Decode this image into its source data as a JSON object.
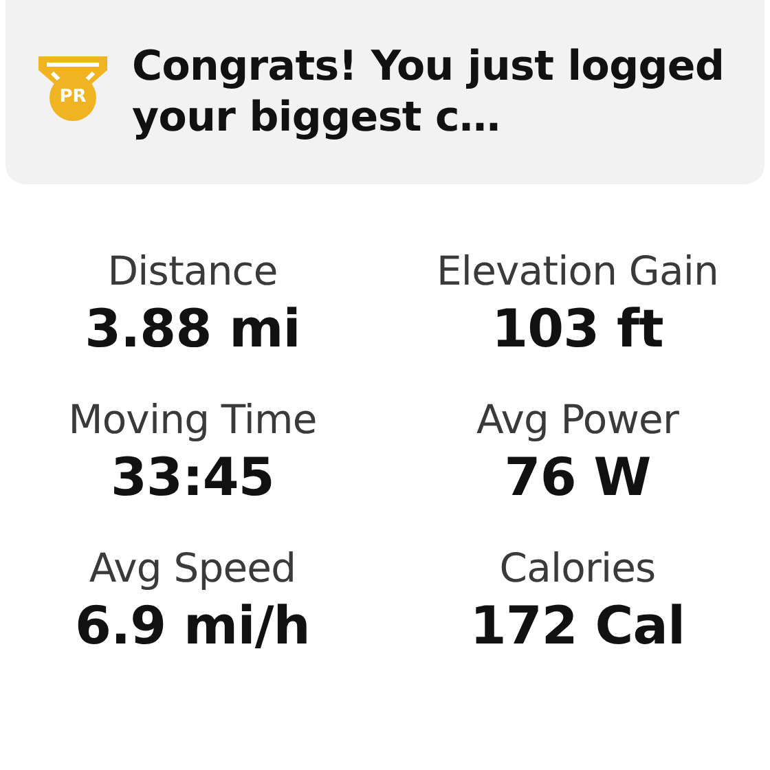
{
  "banner": {
    "badge": "PR",
    "message": "Congrats! You just logged your biggest c…"
  },
  "stats": [
    {
      "label": "Distance",
      "value": "3.88 mi"
    },
    {
      "label": "Elevation Gain",
      "value": "103 ft"
    },
    {
      "label": "Moving Time",
      "value": "33:45"
    },
    {
      "label": "Avg Power",
      "value": "76 W"
    },
    {
      "label": "Avg Speed",
      "value": "6.9 mi/h"
    },
    {
      "label": "Calories",
      "value": "172 Cal"
    }
  ]
}
